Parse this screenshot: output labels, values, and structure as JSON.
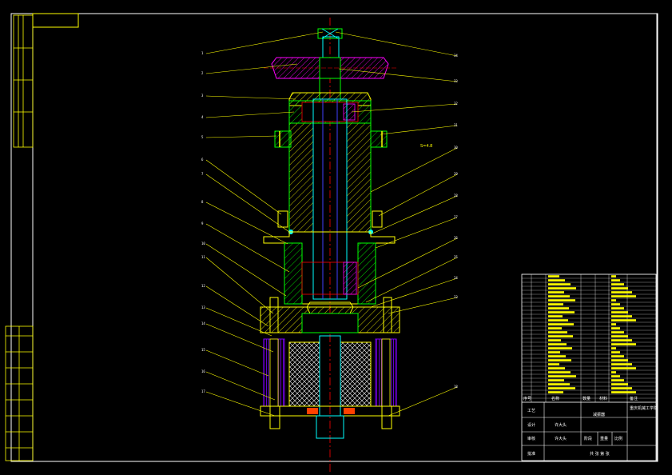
{
  "drawing": {
    "callouts_left": [
      "1",
      "2",
      "3",
      "4",
      "5",
      "6",
      "7",
      "8",
      "9",
      "10",
      "11",
      "12",
      "13",
      "14",
      "15",
      "16",
      "17"
    ],
    "callouts_right": [
      "34",
      "33",
      "32",
      "31",
      "30",
      "29",
      "28",
      "27",
      "26",
      "25",
      "24",
      "23",
      "22",
      "21",
      "20",
      "19",
      "18"
    ],
    "note": "S=4.8",
    "colors": {
      "frame": "#ffffff",
      "yellow": "#ffff00",
      "green": "#00ff00",
      "cyan": "#00ffff",
      "magenta": "#ff00ff",
      "red": "#ff0000",
      "purple": "#8000ff",
      "orange": "#ff4000",
      "bluish": "#4040ff"
    }
  },
  "title_block": {
    "design_label": "设计",
    "check_label": "审核",
    "process_label": "工艺",
    "approve_label": "批准",
    "designer": "许大头",
    "checker": "许大头",
    "drawing_name": "减振器",
    "company": "重庆机械工学院",
    "sheet": "共 张 第 张",
    "qty_labels": [
      "阶段",
      "重量",
      "比例"
    ],
    "header_cols": [
      "序号",
      "名称",
      "数量",
      "材料",
      "备注"
    ]
  }
}
